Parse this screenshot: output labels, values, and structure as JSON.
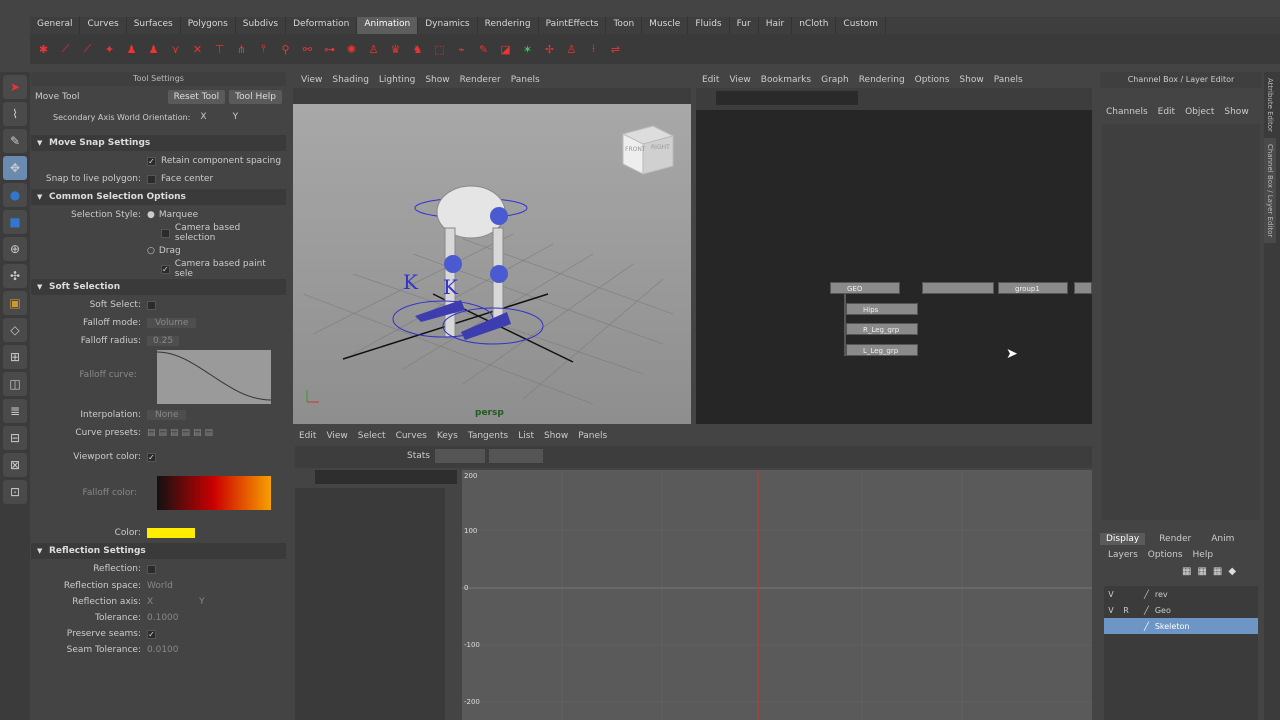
{
  "shelf_tabs": [
    "General",
    "Curves",
    "Surfaces",
    "Polygons",
    "Subdivs",
    "Deformation",
    "Animation",
    "Dynamics",
    "Rendering",
    "PaintEffects",
    "Toon",
    "Muscle",
    "Fluids",
    "Fur",
    "Hair",
    "nCloth",
    "Custom"
  ],
  "active_shelf": "Animation",
  "tool_settings": {
    "title": "Tool Settings",
    "tool_name": "Move Tool",
    "reset_label": "Reset Tool",
    "help_label": "Tool Help",
    "secondary_axis_label": "Secondary Axis World Orientation:",
    "secondary_x": "X",
    "secondary_y": "Y",
    "sections": {
      "move_snap": "Move Snap Settings",
      "common_selection": "Common Selection Options",
      "soft_selection": "Soft Selection",
      "reflection": "Reflection Settings"
    },
    "retain_spacing": "Retain component spacing",
    "snap_live_label": "Snap to live polygon:",
    "face_center": "Face center",
    "selection_style_label": "Selection Style:",
    "marquee": "Marquee",
    "camera_based_selection": "Camera based selection",
    "drag": "Drag",
    "camera_based_paint": "Camera based paint sele",
    "soft_select_label": "Soft Select:",
    "falloff_mode_label": "Falloff mode:",
    "falloff_mode_value": "Volume",
    "falloff_radius_label": "Falloff radius:",
    "falloff_radius_value": "0.25",
    "falloff_curve_label": "Falloff curve:",
    "interpolation_label": "Interpolation:",
    "interpolation_value": "None",
    "curve_presets_label": "Curve presets:",
    "viewport_color_label": "Viewport color:",
    "falloff_color_label": "Falloff color:",
    "color_label": "Color:",
    "reflection_label": "Reflection:",
    "reflection_space_label": "Reflection space:",
    "reflection_space_value": "World",
    "reflection_axis_label": "Reflection axis:",
    "axis_x": "X",
    "axis_y": "Y",
    "tolerance_label": "Tolerance:",
    "tolerance_value": "0.1000",
    "preserve_seams_label": "Preserve seams:",
    "seam_tolerance_label": "Seam Tolerance:",
    "seam_tolerance_value": "0.0100"
  },
  "viewport": {
    "menu": [
      "View",
      "Shading",
      "Lighting",
      "Show",
      "Renderer",
      "Panels"
    ],
    "camera_label": "persp",
    "cube_front": "FRONT",
    "cube_right": "RIGHT"
  },
  "node_editor": {
    "menu": [
      "Edit",
      "View",
      "Bookmarks",
      "Graph",
      "Rendering",
      "Options",
      "Show",
      "Panels"
    ],
    "nodes": [
      "GEO",
      "group1",
      "Hips",
      "R_Leg_grp",
      "L_Leg_grp"
    ]
  },
  "graph_editor": {
    "menu": [
      "Edit",
      "View",
      "Select",
      "Curves",
      "Keys",
      "Tangents",
      "List",
      "Show",
      "Panels"
    ],
    "stats_label": "Stats",
    "y_labels": [
      "200",
      "100",
      "0",
      "-100",
      "-200"
    ]
  },
  "channel_box": {
    "title": "Channel Box / Layer Editor",
    "menu": [
      "Channels",
      "Edit",
      "Object",
      "Show"
    ]
  },
  "layer_editor": {
    "tabs": [
      "Display",
      "Render",
      "Anim"
    ],
    "active_tab": "Display",
    "menu": [
      "Layers",
      "Options",
      "Help"
    ],
    "layers": [
      {
        "v": "V",
        "r": "",
        "name": "rev"
      },
      {
        "v": "V",
        "r": "R",
        "name": "Geo"
      },
      {
        "v": "",
        "r": "",
        "name": "Skeleton"
      }
    ]
  },
  "right_tabs": [
    "Attribute Editor",
    "Channel Box / Layer Editor"
  ]
}
